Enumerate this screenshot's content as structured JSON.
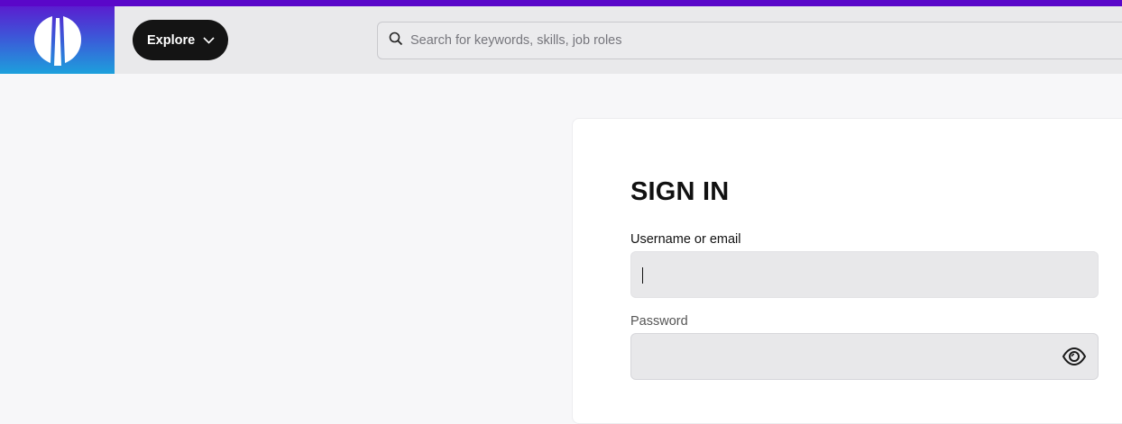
{
  "header": {
    "logo_icon": "brand-logo-icon",
    "explore": {
      "label": "Explore",
      "icon": "chevron-down-icon"
    },
    "search": {
      "placeholder": "Search for keywords, skills, job roles",
      "value": "",
      "icon": "search-icon"
    },
    "colors": {
      "accent_bar": "#5a07c9",
      "logo_gradient_top": "#5a1ed0",
      "logo_gradient_bottom": "#1da0dc",
      "explore_bg": "#141414"
    }
  },
  "signin": {
    "title": "SIGN IN",
    "username_label": "Username or email",
    "username_value": "",
    "password_label": "Password",
    "password_value": "",
    "password_toggle_icon": "eye-icon"
  }
}
